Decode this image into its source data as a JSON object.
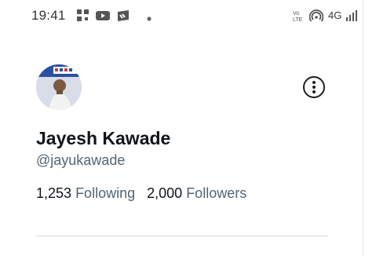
{
  "status_bar": {
    "time": "19:41",
    "network": "4G",
    "icons": [
      "dialpad-icon",
      "youtube-icon",
      "app-icon",
      "dot-icon",
      "volte-icon",
      "hotspot-icon",
      "signal-icon"
    ]
  },
  "profile": {
    "display_name": "Jayesh Kawade",
    "handle": "@jayukawade",
    "avatar_icon": "profile-photo",
    "more_icon": "more-options-icon",
    "following": {
      "count": "1,253",
      "label": "Following"
    },
    "followers": {
      "count": "2,000",
      "label": "Followers"
    }
  },
  "colors": {
    "primary_text": "#0f1419",
    "secondary_text": "#536471",
    "divider": "#d9d9d9"
  }
}
